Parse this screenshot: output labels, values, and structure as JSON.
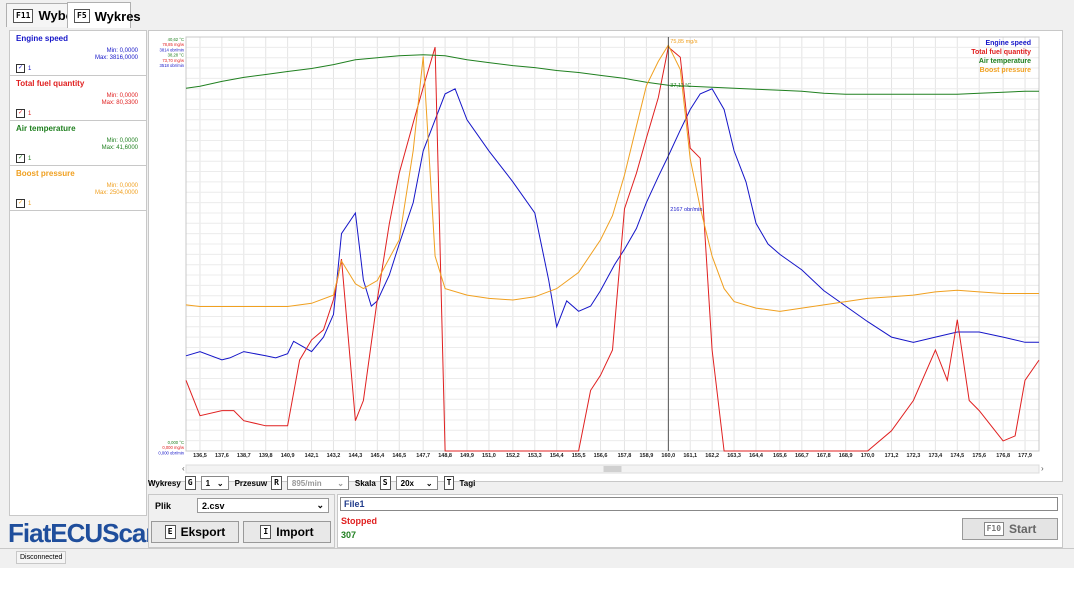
{
  "tabs": [
    {
      "key": "F11",
      "label": "Wybór",
      "active": false
    },
    {
      "key": "F5",
      "label": "Wykres",
      "active": true
    }
  ],
  "signals": [
    {
      "name": "Engine speed",
      "color": "#1515c8",
      "min": "Min: 0,0000",
      "max": "Max: 3816,0000",
      "checked": "1"
    },
    {
      "name": "Total fuel quantity",
      "color": "#e02020",
      "min": "Min: 0,0000",
      "max": "Max: 80,3300",
      "checked": "1"
    },
    {
      "name": "Air temperature",
      "color": "#208020",
      "min": "Min: 0,0000",
      "max": "Max: 41,6000",
      "checked": "1"
    },
    {
      "name": "Boost pressure",
      "color": "#f0a020",
      "min": "Min: 0,0000",
      "max": "Max: 2504,0000",
      "checked": "1"
    }
  ],
  "logo": "FiatECUScan",
  "controls": {
    "wykresy_label": "Wykresy",
    "wykresy_key": "G",
    "wykresy_value": "1",
    "przesuw_label": "Przesuw",
    "przesuw_key": "R",
    "przesuw_value": "895/min",
    "skala_label": "Skala",
    "skala_key": "S",
    "skala_value": "20x",
    "tagi_key": "T",
    "tagi_label": "Tagi"
  },
  "file": {
    "label": "Plik",
    "value": "2.csv",
    "export_key": "E",
    "export_label": "Eksport",
    "import_key": "I",
    "import_label": "Import"
  },
  "status": {
    "file_name": "File1",
    "state": "Stopped",
    "count": "307",
    "start_key": "F10",
    "start_label": "Start"
  },
  "connection": "Disconnected",
  "chart_data": {
    "type": "line",
    "x_ticks": [
      "136,5",
      "137,6",
      "138,7",
      "139,8",
      "140,9",
      "142,1",
      "143,2",
      "144,3",
      "145,4",
      "146,5",
      "147,7",
      "148,8",
      "149,9",
      "151,0",
      "152,2",
      "153,3",
      "154,4",
      "155,5",
      "156,6",
      "157,8",
      "158,9",
      "160,0",
      "161,1",
      "162,2",
      "163,3",
      "164,4",
      "165,6",
      "166,7",
      "167,8",
      "168,9",
      "170,0",
      "171,2",
      "172,3",
      "173,4",
      "174,5",
      "175,6",
      "176,8",
      "177,9"
    ],
    "legend": [
      "Engine speed",
      "Total fuel quantity",
      "Air temperature",
      "Boost pressure"
    ],
    "legend_position": "top-right",
    "grid": true,
    "cursor_x": 160.0,
    "cursor_labels": [
      "2167 obr/min",
      "37,11 °C",
      "75,85 mg/s"
    ],
    "y_axis_top_labels": [
      "40,62 °C",
      "78,85 mg/w",
      "3814 obr/min",
      "38,28 °C",
      "73,70 mg/w",
      "3518 obr/min"
    ],
    "y_axis_bottom_labels": [
      "0,000 °C",
      "0,000 mg/w",
      "0,000 obr/min"
    ],
    "xlim": [
      135.8,
      178.6
    ],
    "series": [
      {
        "name": "Engine speed",
        "color": "#1515c8",
        "ylim": [
          0,
          4000
        ],
        "x": [
          135.8,
          136.5,
          137.6,
          138.0,
          138.7,
          139.8,
          140.3,
          140.9,
          141.2,
          142.1,
          142.7,
          143.2,
          143.6,
          144.3,
          144.7,
          145.1,
          145.4,
          146.0,
          146.5,
          147.2,
          147.7,
          148.3,
          148.8,
          149.3,
          149.9,
          151.0,
          152.2,
          153.3,
          154.0,
          154.4,
          154.9,
          155.5,
          156.1,
          156.6,
          157.3,
          157.8,
          158.4,
          158.9,
          159.5,
          160.0,
          160.6,
          161.1,
          161.6,
          162.2,
          162.8,
          163.3,
          163.9,
          164.4,
          165.0,
          165.6,
          166.7,
          167.8,
          168.9,
          170.0,
          171.2,
          172.3,
          173.4,
          174.5,
          175.6,
          176.8,
          177.9,
          178.6
        ],
        "y": [
          920,
          960,
          880,
          900,
          960,
          920,
          900,
          940,
          1060,
          960,
          1100,
          1320,
          2100,
          2300,
          1650,
          1400,
          1450,
          1700,
          2000,
          2400,
          2900,
          3200,
          3450,
          3500,
          3200,
          2900,
          2600,
          2300,
          1650,
          1200,
          1450,
          1350,
          1400,
          1550,
          1800,
          1950,
          2150,
          2400,
          2650,
          2850,
          3100,
          3300,
          3450,
          3500,
          3300,
          2900,
          2600,
          2200,
          2000,
          1900,
          1750,
          1550,
          1400,
          1250,
          1100,
          1050,
          1100,
          1150,
          1150,
          1100,
          1050,
          1050
        ]
      },
      {
        "name": "Total fuel quantity",
        "color": "#e02020",
        "ylim": [
          0,
          82
        ],
        "x": [
          135.8,
          136.5,
          137.6,
          138.2,
          138.7,
          139.8,
          140.9,
          141.5,
          142.1,
          142.7,
          143.2,
          143.6,
          144.3,
          144.7,
          145.4,
          146.0,
          146.5,
          147.2,
          147.7,
          148.3,
          148.8,
          149.3,
          149.9,
          151.0,
          152.2,
          153.3,
          154.4,
          154.9,
          155.5,
          156.1,
          156.6,
          157.2,
          157.8,
          158.4,
          158.9,
          159.5,
          160.0,
          160.6,
          161.1,
          161.6,
          162.2,
          162.8,
          163.3,
          164.4,
          165.6,
          166.7,
          167.8,
          168.9,
          170.0,
          171.2,
          172.3,
          173.4,
          174.0,
          174.5,
          175.1,
          175.6,
          176.2,
          176.8,
          177.4,
          177.9,
          178.6
        ],
        "y": [
          14,
          7,
          8,
          8,
          6,
          5,
          5,
          18,
          22,
          24,
          30,
          38,
          6,
          10,
          30,
          45,
          55,
          65,
          72,
          80,
          0,
          0,
          0,
          0,
          0,
          0,
          0,
          0,
          0,
          12,
          15,
          20,
          48,
          55,
          62,
          70,
          80,
          78,
          60,
          58,
          20,
          0,
          0,
          0,
          0,
          0,
          0,
          0,
          0,
          4,
          10,
          20,
          14,
          26,
          10,
          8,
          5,
          2,
          3,
          14,
          18
        ]
      },
      {
        "name": "Air temperature",
        "color": "#208020",
        "ylim": [
          0,
          42
        ],
        "x": [
          135.8,
          136.5,
          137.6,
          138.7,
          139.8,
          140.9,
          142.1,
          143.2,
          144.3,
          145.4,
          146.5,
          147.7,
          148.8,
          149.9,
          151.0,
          152.2,
          153.3,
          154.4,
          155.5,
          156.6,
          157.8,
          158.9,
          160.0,
          161.1,
          162.2,
          163.3,
          164.4,
          165.6,
          166.7,
          167.8,
          168.9,
          170.0,
          171.2,
          172.3,
          173.4,
          174.5,
          175.6,
          176.8,
          177.9,
          178.6
        ],
        "y": [
          36.8,
          37.0,
          37.5,
          37.9,
          38.2,
          38.5,
          38.8,
          39.2,
          39.7,
          39.9,
          40.1,
          40.2,
          40.1,
          39.7,
          39.4,
          39.1,
          38.9,
          38.6,
          38.4,
          38.1,
          37.8,
          37.4,
          37.1,
          37.0,
          36.9,
          36.8,
          36.7,
          36.6,
          36.5,
          36.3,
          36.2,
          36.2,
          36.2,
          36.2,
          36.2,
          36.2,
          36.3,
          36.4,
          36.5,
          36.5
        ]
      },
      {
        "name": "Boost pressure",
        "color": "#f0a020",
        "ylim": [
          0,
          2550
        ],
        "x": [
          135.8,
          136.5,
          137.6,
          138.7,
          139.8,
          140.9,
          142.1,
          143.2,
          143.6,
          144.3,
          144.7,
          145.4,
          146.5,
          147.2,
          147.7,
          148.3,
          148.8,
          149.9,
          151.0,
          152.2,
          153.3,
          154.4,
          155.5,
          156.6,
          157.2,
          157.8,
          158.4,
          158.9,
          159.5,
          160.0,
          160.6,
          161.1,
          161.6,
          162.2,
          162.8,
          163.3,
          164.4,
          165.6,
          166.7,
          167.8,
          168.9,
          170.0,
          171.2,
          172.3,
          173.4,
          174.5,
          175.6,
          176.8,
          177.9,
          178.6
        ],
        "y": [
          900,
          890,
          890,
          890,
          890,
          890,
          910,
          960,
          1170,
          1030,
          1000,
          1050,
          1300,
          1850,
          2430,
          1200,
          1000,
          960,
          940,
          930,
          950,
          1000,
          1100,
          1300,
          1450,
          1700,
          2000,
          2250,
          2400,
          2500,
          2350,
          1800,
          1500,
          1200,
          1000,
          920,
          880,
          860,
          880,
          900,
          920,
          940,
          950,
          960,
          980,
          990,
          980,
          970,
          970,
          970
        ]
      }
    ]
  }
}
